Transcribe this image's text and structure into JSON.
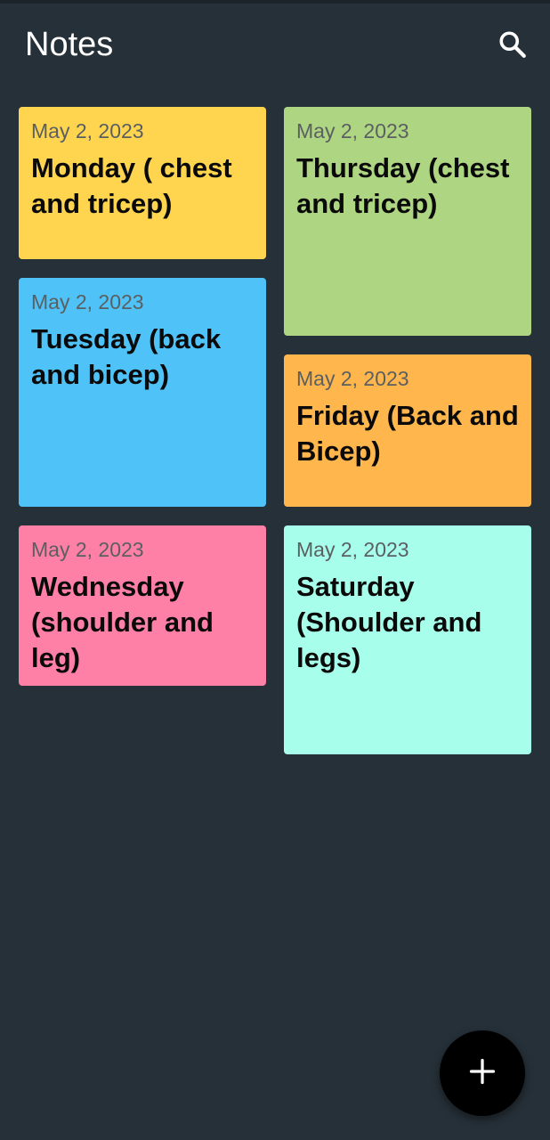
{
  "app": {
    "title": "Notes"
  },
  "header": {
    "search_icon": "search-icon"
  },
  "notes": [
    {
      "date": "May 2, 2023",
      "title": "Monday ( chest and tricep)",
      "color": "#FFD54F"
    },
    {
      "date": "May 2, 2023",
      "title": "Thursday (chest and tricep)",
      "color": "#AED581"
    },
    {
      "date": "May 2, 2023",
      "title": "Tuesday (back and bicep)",
      "color": "#4FC3F7"
    },
    {
      "date": "May 2, 2023",
      "title": "Friday (Back and Bicep)",
      "color": "#FFB74D"
    },
    {
      "date": "May 2, 2023",
      "title": "Wednesday (shoulder and leg)",
      "color": "#FF80A6"
    },
    {
      "date": "May 2, 2023",
      "title": "Saturday (Shoulder and legs)",
      "color": "#A7FFEB"
    }
  ],
  "fab": {
    "icon": "plus-icon"
  },
  "colors": {
    "background": "#263038",
    "text_primary": "#FFFFFF",
    "fab_background": "#000000"
  }
}
